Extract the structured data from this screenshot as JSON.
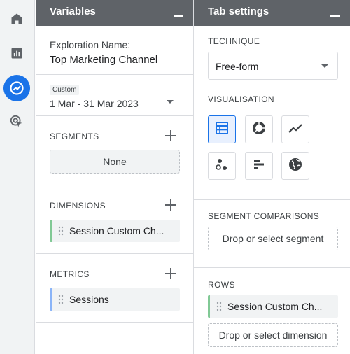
{
  "rail": {
    "items": [
      {
        "name": "home"
      },
      {
        "name": "reports"
      },
      {
        "name": "explore",
        "active": true
      },
      {
        "name": "advertising"
      }
    ],
    "active_color": "#1a73e8"
  },
  "variables": {
    "title": "Variables",
    "exploration_label": "Exploration Name:",
    "exploration_name": "Top Marketing Channel",
    "date_badge": "Custom",
    "date_range": "1 Mar - 31 Mar 2023",
    "segments_label": "SEGMENTS",
    "segments_value": "None",
    "dimensions_label": "DIMENSIONS",
    "dimension_item": "Session Custom Ch...",
    "dimension_color": "#81c995",
    "metrics_label": "METRICS",
    "metric_item": "Sessions",
    "metric_color": "#8ab4f8"
  },
  "tab_settings": {
    "title": "Tab settings",
    "technique_label": "TECHNIQUE",
    "technique_value": "Free-form",
    "visualisation_label": "VISUALISATION",
    "visualisations": [
      {
        "name": "table",
        "selected": true
      },
      {
        "name": "donut-chart"
      },
      {
        "name": "line-chart"
      },
      {
        "name": "scatter-plot"
      },
      {
        "name": "bar-chart"
      },
      {
        "name": "geo-map"
      }
    ],
    "segment_comparisons_label": "SEGMENT COMPARISONS",
    "segment_drop": "Drop or select segment",
    "rows_label": "ROWS",
    "row_item": "Session Custom Ch...",
    "row_color": "#81c995",
    "dimension_drop": "Drop or select dimension"
  }
}
